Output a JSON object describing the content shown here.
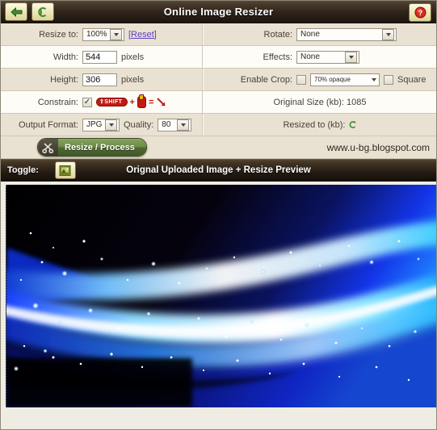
{
  "window": {
    "title": "Online Image Resizer",
    "back_icon": "back-arrow-icon",
    "refresh_icon": "refresh-icon",
    "help_icon": "help-icon"
  },
  "form": {
    "resize_to": {
      "label": "Resize to:",
      "value": "100%",
      "reset_link": "[Reset]"
    },
    "rotate": {
      "label": "Rotate:",
      "value": "None"
    },
    "width": {
      "label": "Width:",
      "value": "544",
      "unit": "pixels"
    },
    "effects": {
      "label": "Effects:",
      "value": "None"
    },
    "height": {
      "label": "Height:",
      "value": "306",
      "unit": "pixels"
    },
    "enable_crop": {
      "label": "Enable Crop:",
      "checked": false,
      "opacity_value": "70% opaque",
      "square_label": "Square",
      "square_checked": false
    },
    "constrain": {
      "label": "Constrain:",
      "checked": true,
      "hint_shift": "SHIFT",
      "hint_plus": "+",
      "hint_equals": "=",
      "hint_mouse_icon": "mouse-icon",
      "hint_result_icon": "diagonal-resize-icon"
    },
    "original_size": {
      "label": "Original Size (kb):",
      "value": "1085"
    },
    "output_format": {
      "label": "Output Format:",
      "value": "JPG"
    },
    "quality": {
      "label": "Quality:",
      "value": "80"
    },
    "resized_to": {
      "label": "Resized to (kb):",
      "value": "",
      "icon": "refresh-small-icon"
    }
  },
  "action": {
    "process_label": "Resize / Process",
    "process_icon": "scissors-icon",
    "watermark": "www.u-bg.blogspot.com"
  },
  "toggle": {
    "label": "Toggle:",
    "icon": "image-icon",
    "title": "Orignal Uploaded Image + Resize Preview"
  },
  "preview": {
    "alt": "Abstract blue glowing wave with sparkling particles on black background"
  },
  "colors": {
    "titlebar_dark": "#2e2319",
    "row_tan": "#e9e2d3",
    "row_white": "#fdfcf7",
    "accent_green": "#6d8b47",
    "accent_red": "#c01b15",
    "link_purple": "#5d3fbf",
    "image_blue": "#1030ff",
    "image_cyan": "#23c8ff"
  }
}
